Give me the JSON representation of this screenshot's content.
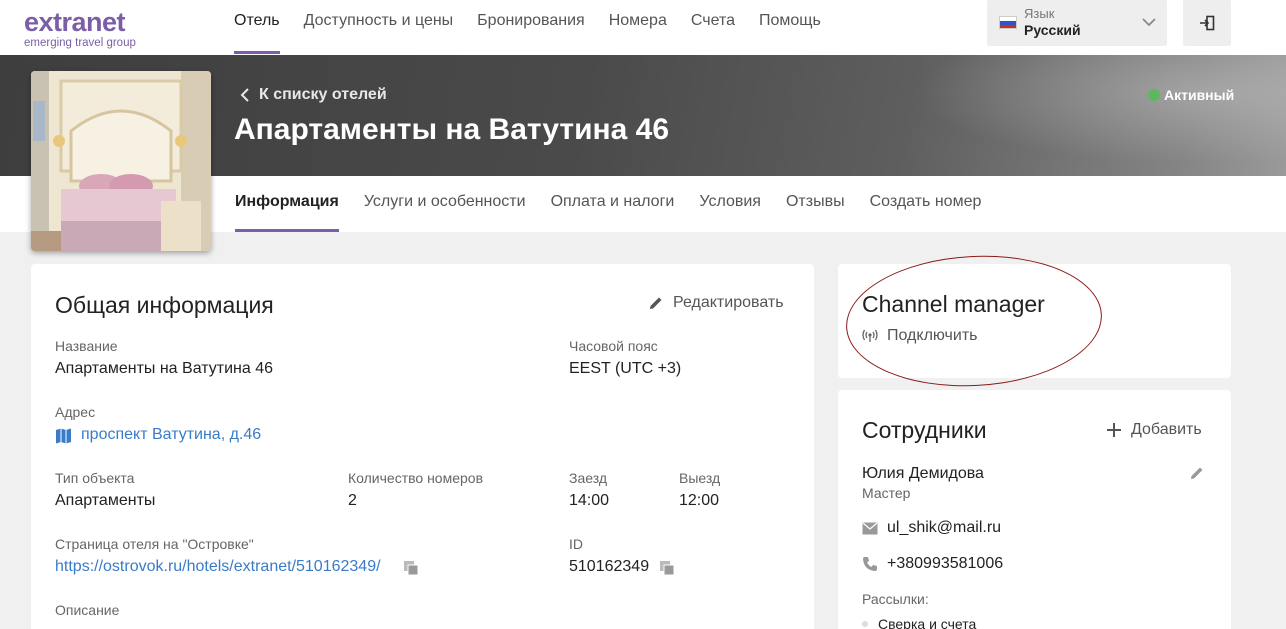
{
  "logo": {
    "main": "extranet",
    "sub": "emerging travel group"
  },
  "nav": [
    {
      "label": "Отель",
      "active": true
    },
    {
      "label": "Доступность и цены",
      "active": false
    },
    {
      "label": "Бронирования",
      "active": false
    },
    {
      "label": "Номера",
      "active": false
    },
    {
      "label": "Счета",
      "active": false
    },
    {
      "label": "Помощь",
      "active": false
    }
  ],
  "language": {
    "caption": "Язык",
    "value": "Русский",
    "flag": "ru-flag"
  },
  "hero": {
    "back_label": "К списку отелей",
    "hotel_name": "Апартаменты на Ватутина 46",
    "status": "Активный",
    "status_color": "#5cb85c"
  },
  "subtabs": [
    {
      "label": "Информация",
      "active": true
    },
    {
      "label": "Услуги и особенности",
      "active": false
    },
    {
      "label": "Оплата и налоги",
      "active": false
    },
    {
      "label": "Условия",
      "active": false
    },
    {
      "label": "Отзывы",
      "active": false
    },
    {
      "label": "Создать номер",
      "active": false
    }
  ],
  "general": {
    "title": "Общая информация",
    "edit_label": "Редактировать",
    "name_label": "Название",
    "name_value": "Апартаменты на Ватутина 46",
    "timezone_label": "Часовой пояс",
    "timezone_value": "EEST (UTC +3)",
    "address_label": "Адрес",
    "address_value": "проспект Ватутина, д.46",
    "type_label": "Тип объекта",
    "type_value": "Апартаменты",
    "rooms_label": "Количество номеров",
    "rooms_value": "2",
    "checkin_label": "Заезд",
    "checkin_value": "14:00",
    "checkout_label": "Выезд",
    "checkout_value": "12:00",
    "page_label": "Страница отеля на \"Островке\"",
    "page_value": "https://ostrovok.ru/hotels/extranet/510162349/",
    "id_label": "ID",
    "id_value": "510162349",
    "description_label": "Описание"
  },
  "channel_manager": {
    "title": "Channel manager",
    "connect_label": "Подключить"
  },
  "staff": {
    "title": "Сотрудники",
    "add_label": "Добавить",
    "member_name": "Юлия Демидова",
    "member_role": "Мастер",
    "email": "ul_shik@mail.ru",
    "phone": "+380993581006",
    "mailings_label": "Рассылки:",
    "mailing_item": "Сверка и счета"
  },
  "colors": {
    "accent": "#7b5ea7",
    "link": "#3a7bc8",
    "annotation": "#8b1a1a"
  }
}
